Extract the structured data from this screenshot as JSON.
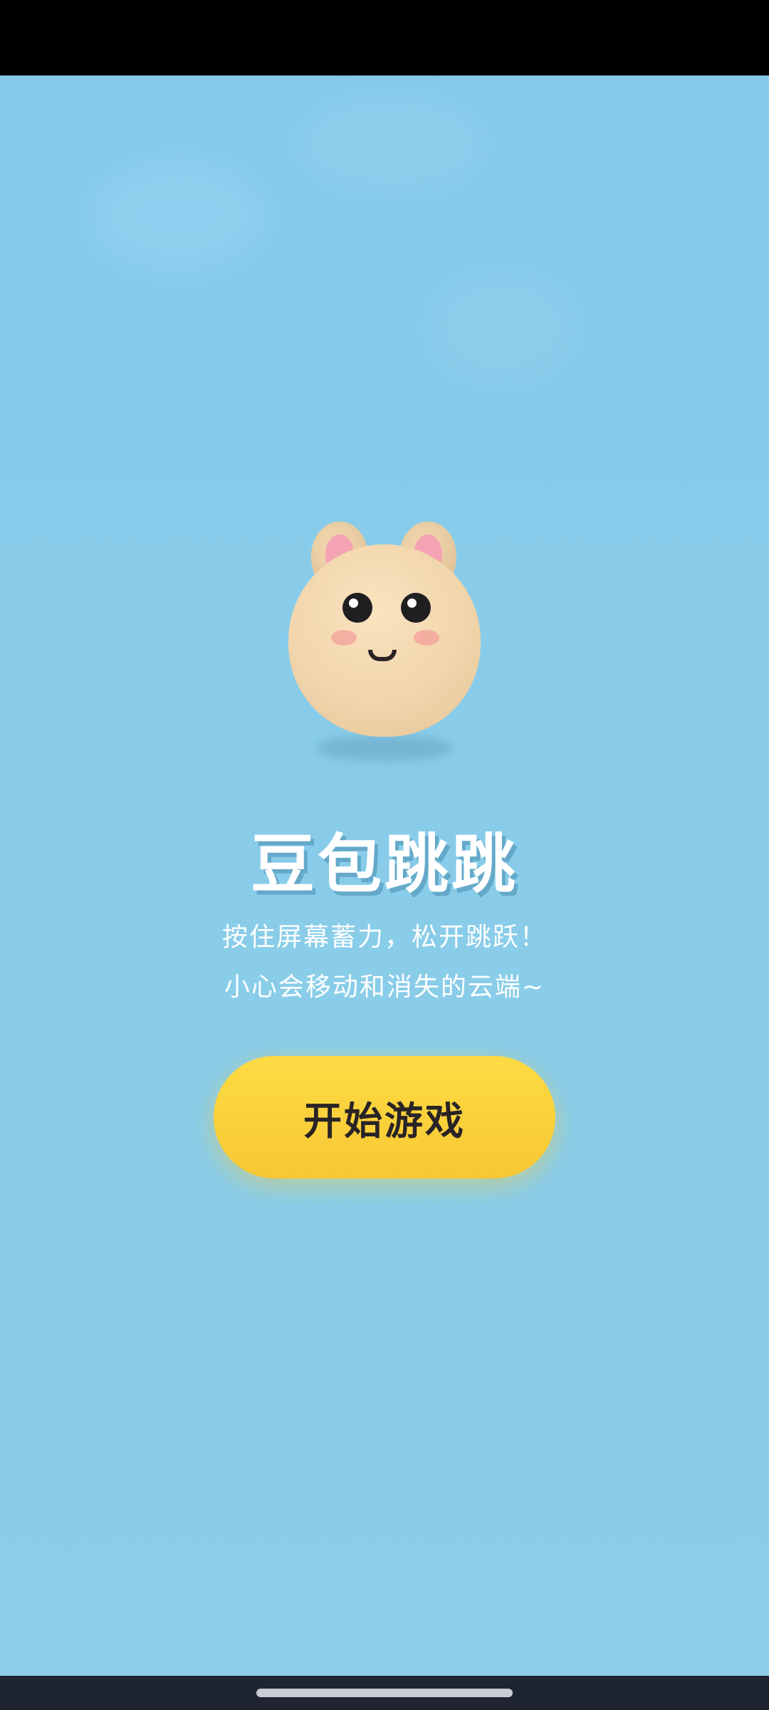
{
  "game": {
    "title": "豆包跳跳",
    "instructions": [
      "按住屏幕蓄力，松开跳跃！",
      "小心会移动和消失的云端~"
    ],
    "start_button_label": "开始游戏"
  },
  "mascot": {
    "icon": "bunny-bean-mascot-icon",
    "colors": {
      "body": "#f1d5ab",
      "ear_inner": "#f4a3b2",
      "eyes": "#1f1f22",
      "blush": "#f49696"
    }
  },
  "colors": {
    "background": "#89cbe8",
    "button": "#fbd43c",
    "button_text": "#2a2426",
    "title_text": "#ffffff",
    "status_bar": "#000000",
    "nav_bar": "#1f2431"
  }
}
